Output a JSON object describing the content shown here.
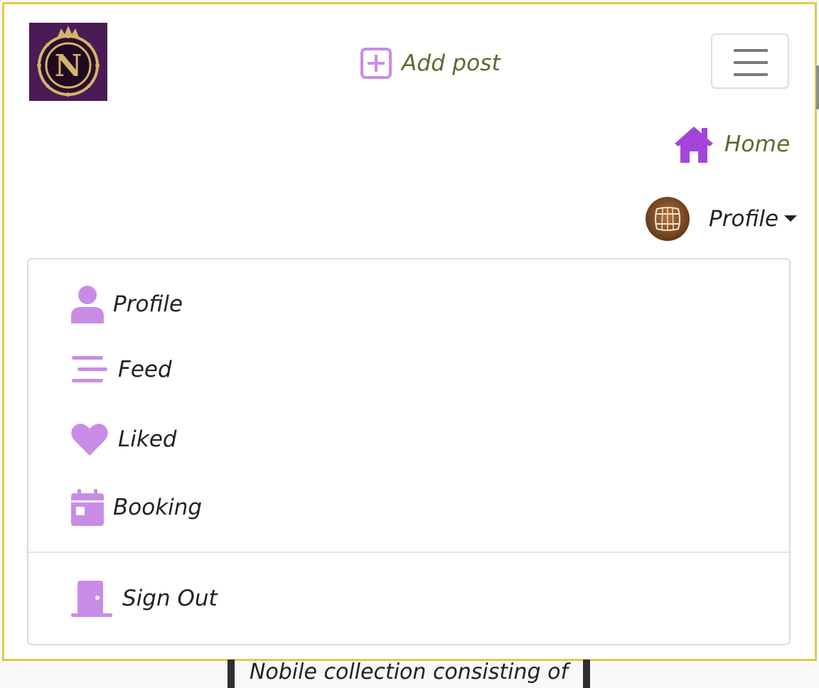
{
  "navbar": {
    "brand": {
      "logo_letter": "N",
      "logo_icon": "crown-crest-logo"
    },
    "add_post": {
      "label": "Add post",
      "icon": "plus-square-icon"
    },
    "toggler_icon": "hamburger-icon",
    "home": {
      "label": "Home",
      "icon": "home-icon"
    },
    "profile_menu": {
      "label": "Profile",
      "avatar_icon": "barrel-avatar",
      "items": [
        {
          "label": "Profile",
          "icon": "user-icon"
        },
        {
          "label": "Feed",
          "icon": "feed-lines-icon"
        },
        {
          "label": "Liked",
          "icon": "heart-icon"
        },
        {
          "label": "Booking",
          "icon": "calendar-icon"
        }
      ],
      "footer_item": {
        "label": "Sign Out",
        "icon": "door-icon"
      }
    }
  },
  "content": {
    "preview_text": "Nobile collection consisting of"
  },
  "colors": {
    "accent_purple": "#c98ce6",
    "home_purple": "#a445d9",
    "link_olive": "#5a6a2e",
    "frame_yellow": "#dccd4c",
    "logo_bg": "#4b1b55",
    "logo_gold": "#d4b36a"
  }
}
